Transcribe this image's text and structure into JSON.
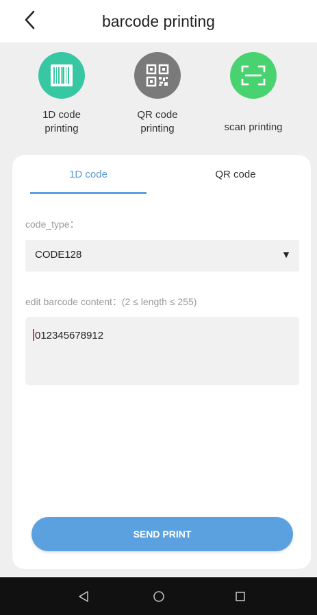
{
  "header": {
    "title": "barcode printing",
    "back_icon": "chevron-left-icon"
  },
  "modes": [
    {
      "label": "1D code\nprinting",
      "icon": "barcode-icon",
      "color": "#37c7a2"
    },
    {
      "label": "QR code\nprinting",
      "icon": "qr-code-icon",
      "color": "#7a7a7a"
    },
    {
      "label": "scan printing",
      "icon": "scan-icon",
      "color": "#49d270"
    }
  ],
  "tabs": [
    {
      "label": "1D code",
      "active": true
    },
    {
      "label": "QR code",
      "active": false
    }
  ],
  "form": {
    "code_type_label": "code_type：",
    "code_type_value": "CODE128",
    "content_label": "edit barcode content：(2 ≤ length ≤ 255)",
    "content_value": "012345678912"
  },
  "send_button": {
    "label": "SEND PRINT",
    "color": "#5ba1e0"
  },
  "nav": {
    "back": "back-icon",
    "home": "home-icon",
    "recents": "recents-icon"
  }
}
